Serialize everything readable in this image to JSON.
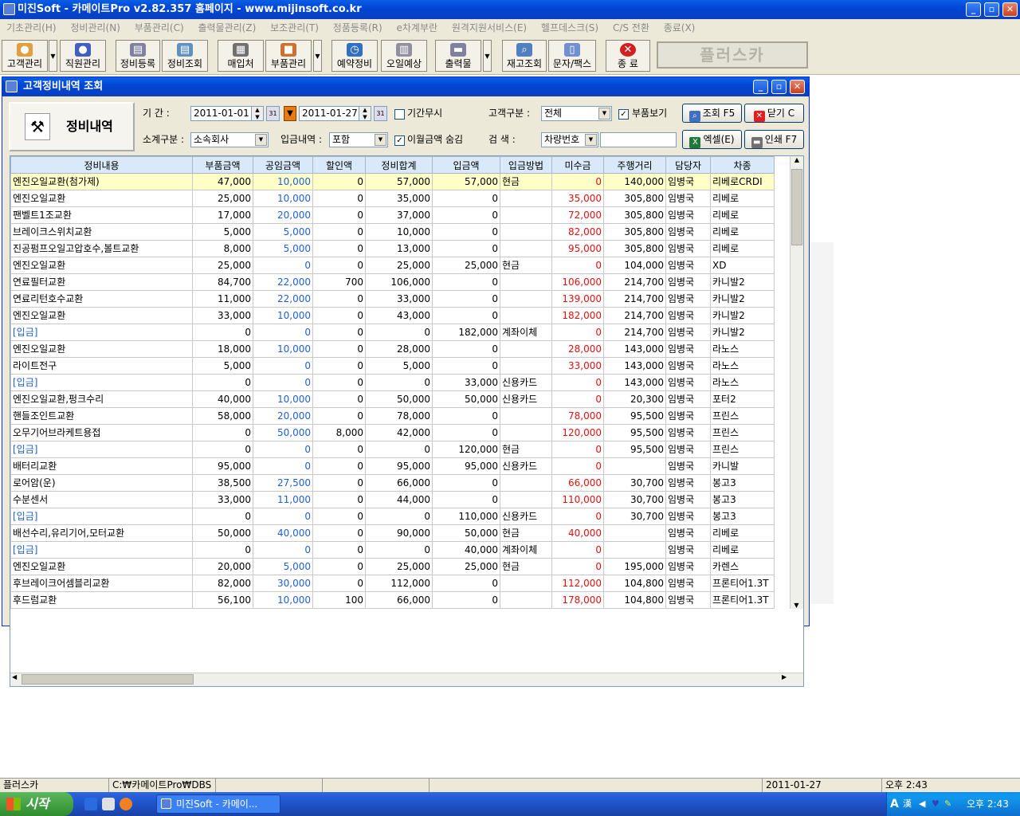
{
  "app": {
    "title": "미진Soft - 카메이트Pro v2.82.357 홈페이지 - www.mijinsoft.co.kr"
  },
  "menu": [
    "기초관리(H)",
    "정비관리(N)",
    "부품관리(C)",
    "출력물관리(Z)",
    "보조관리(T)",
    "정품등록(R)",
    "e차계부란",
    "원격지원서비스(E)",
    "헬프데스크(S)",
    "C/S 전환",
    "종료(X)"
  ],
  "toolbar": {
    "customer": "고객관리",
    "staff": "직원관리",
    "repair_reg": "정비등록",
    "repair_view": "정비조회",
    "vendor": "매입처",
    "parts": "부품관리",
    "booking": "예약정비",
    "oil": "오일예상",
    "print": "출력물",
    "stock": "재고조회",
    "sms": "문자/팩스",
    "exit": "종 료",
    "plus": "플러스카"
  },
  "window": {
    "title": "고객정비내역 조회",
    "panel_title": "정비내역"
  },
  "filters": {
    "period_label": "기    간 :",
    "date_from": "2011-01-01",
    "date_to": "2011-01-27",
    "no_period_label": "기간무시",
    "customer_type_label": "고객구분 :",
    "customer_type": "전체",
    "show_parts_label": "부품보기",
    "subtotal_label": "소계구분 :",
    "subtotal": "소속회사",
    "income_label": "입금내역 :",
    "income": "포함",
    "hide_carry_label": "이월금액 숨김",
    "search_label": "검      색 :",
    "search_type": "차량번호",
    "search_value": ""
  },
  "buttons": {
    "search": "조회 F5",
    "close": "닫기 C",
    "excel": "엑셀(E)",
    "print": "인쇄 F7"
  },
  "grid": {
    "columns": [
      "정비내용",
      "부품금액",
      "공임금액",
      "할인액",
      "정비합계",
      "입금액",
      "입금방법",
      "미수금",
      "주행거리",
      "담당자",
      "차종"
    ],
    "rows": [
      [
        "엔진오일교환(첨가제)",
        "47,000",
        "10,000",
        "0",
        "57,000",
        "57,000",
        "현금",
        "0",
        "140,000",
        "임병국",
        "리베로CRDI"
      ],
      [
        "엔진오일교환",
        "25,000",
        "10,000",
        "0",
        "35,000",
        "0",
        "",
        "35,000",
        "305,800",
        "임병국",
        "리베로"
      ],
      [
        "팬벨트1조교환",
        "17,000",
        "20,000",
        "0",
        "37,000",
        "0",
        "",
        "72,000",
        "305,800",
        "임병국",
        "리베로"
      ],
      [
        "브레이크스위치교환",
        "5,000",
        "5,000",
        "0",
        "10,000",
        "0",
        "",
        "82,000",
        "305,800",
        "임병국",
        "리베로"
      ],
      [
        "진공펌프오일고압호수,볼트교환",
        "8,000",
        "5,000",
        "0",
        "13,000",
        "0",
        "",
        "95,000",
        "305,800",
        "임병국",
        "리베로"
      ],
      [
        "엔진오일교환",
        "25,000",
        "0",
        "0",
        "25,000",
        "25,000",
        "현금",
        "0",
        "104,000",
        "임병국",
        "XD"
      ],
      [
        "연료필터교환",
        "84,700",
        "22,000",
        "700",
        "106,000",
        "0",
        "",
        "106,000",
        "214,700",
        "임병국",
        "카니발2"
      ],
      [
        "연료리턴호수교환",
        "11,000",
        "22,000",
        "0",
        "33,000",
        "0",
        "",
        "139,000",
        "214,700",
        "임병국",
        "카니발2"
      ],
      [
        "엔진오일교환",
        "33,000",
        "10,000",
        "0",
        "43,000",
        "0",
        "",
        "182,000",
        "214,700",
        "임병국",
        "카니발2"
      ],
      [
        "[입금]",
        "0",
        "0",
        "0",
        "0",
        "182,000",
        "계좌이체",
        "0",
        "214,700",
        "임병국",
        "카니발2"
      ],
      [
        "엔진오일교환",
        "18,000",
        "10,000",
        "0",
        "28,000",
        "0",
        "",
        "28,000",
        "143,000",
        "임병국",
        "라노스"
      ],
      [
        "라이트전구",
        "5,000",
        "0",
        "0",
        "5,000",
        "0",
        "",
        "33,000",
        "143,000",
        "임병국",
        "라노스"
      ],
      [
        "[입금]",
        "0",
        "0",
        "0",
        "0",
        "33,000",
        "신용카드",
        "0",
        "143,000",
        "임병국",
        "라노스"
      ],
      [
        "엔진오일교환,펑크수리",
        "40,000",
        "10,000",
        "0",
        "50,000",
        "50,000",
        "신용카드",
        "0",
        "20,300",
        "임병국",
        "포터2"
      ],
      [
        "핸들조인트교환",
        "58,000",
        "20,000",
        "0",
        "78,000",
        "0",
        "",
        "78,000",
        "95,500",
        "임병국",
        "프린스"
      ],
      [
        "오무기어브라케트용접",
        "0",
        "50,000",
        "8,000",
        "42,000",
        "0",
        "",
        "120,000",
        "95,500",
        "임병국",
        "프린스"
      ],
      [
        "[입금]",
        "0",
        "0",
        "0",
        "0",
        "120,000",
        "현금",
        "0",
        "95,500",
        "임병국",
        "프린스"
      ],
      [
        "배터리교환",
        "95,000",
        "0",
        "0",
        "95,000",
        "95,000",
        "신용카드",
        "0",
        "",
        "임병국",
        "카니발"
      ],
      [
        "로어암(운)",
        "38,500",
        "27,500",
        "0",
        "66,000",
        "0",
        "",
        "66,000",
        "30,700",
        "임병국",
        "봉고3"
      ],
      [
        "수분센서",
        "33,000",
        "11,000",
        "0",
        "44,000",
        "0",
        "",
        "110,000",
        "30,700",
        "임병국",
        "봉고3"
      ],
      [
        "[입금]",
        "0",
        "0",
        "0",
        "0",
        "110,000",
        "신용카드",
        "0",
        "30,700",
        "임병국",
        "봉고3"
      ],
      [
        "배선수리,유리기어,모터교환",
        "50,000",
        "40,000",
        "0",
        "90,000",
        "50,000",
        "현금",
        "40,000",
        "",
        "임병국",
        "리베로"
      ],
      [
        "[입금]",
        "0",
        "0",
        "0",
        "0",
        "40,000",
        "계좌이체",
        "0",
        "",
        "임병국",
        "리베로"
      ],
      [
        "엔진오일교환",
        "20,000",
        "5,000",
        "0",
        "25,000",
        "25,000",
        "현금",
        "0",
        "195,000",
        "임병국",
        "카렌스"
      ],
      [
        "후브레이크어셈블리교환",
        "82,000",
        "30,000",
        "0",
        "112,000",
        "0",
        "",
        "112,000",
        "104,800",
        "임병국",
        "프론티어1.3T"
      ],
      [
        "후드럼교환",
        "56,100",
        "10,000",
        "100",
        "66,000",
        "0",
        "",
        "178,000",
        "104,800",
        "임병국",
        "프론티어1.3T"
      ]
    ]
  },
  "statusbar": {
    "name": "플러스카",
    "path": "C:₩카메이트Pro₩DBS",
    "date": "2011-01-27",
    "time": "오후 2:43"
  },
  "taskbar": {
    "start": "시작",
    "item": "미진Soft - 카메이...",
    "clock": "오후 2:43"
  },
  "colors": {
    "titlebar": "#0046d5",
    "header": "#d9e9f9",
    "selected_row": "#ffffc8",
    "labor_blue": "#1f5fd6",
    "unpaid_red": "#e01010"
  }
}
